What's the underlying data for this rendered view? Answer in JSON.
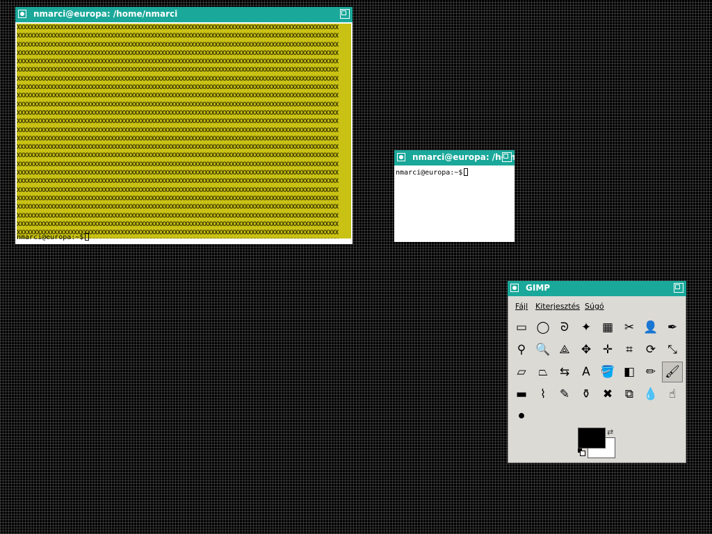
{
  "terminal_main": {
    "title": "nmarci@europa: /home/nmarci",
    "prompt": "nmarci@europa:~$",
    "pattern_text": "XXXXXXXXXXXXXXXXXXXXXXXXXXXXXXXXXXXXXXXXXXXXXXXXXXXXXXXXXXXXXXXXXXXXXXXXXXXXXXXXXXXXXXXXXXXXXXXX",
    "background_color": "#c9c214"
  },
  "terminal_small": {
    "title": "nmarci@europa: /hom",
    "prompt": "nmarci@europa:~$"
  },
  "gimp": {
    "title": "GIMP",
    "menu": {
      "file": "Fájl",
      "extensions": "Kiterjesztés",
      "help": "Súgó"
    },
    "tools": [
      {
        "name": "rect-select-icon",
        "glyph": "▭"
      },
      {
        "name": "ellipse-select-icon",
        "glyph": "◯"
      },
      {
        "name": "lasso-icon",
        "glyph": "ᘐ"
      },
      {
        "name": "magic-wand-icon",
        "glyph": "✦"
      },
      {
        "name": "select-by-color-icon",
        "glyph": "▦"
      },
      {
        "name": "scissors-icon",
        "glyph": "✂"
      },
      {
        "name": "foreground-select-icon",
        "glyph": "👤"
      },
      {
        "name": "paths-icon",
        "glyph": "✒"
      },
      {
        "name": "color-picker-icon",
        "glyph": "⚲"
      },
      {
        "name": "zoom-icon",
        "glyph": "🔍"
      },
      {
        "name": "measure-icon",
        "glyph": "⟁"
      },
      {
        "name": "move-icon",
        "glyph": "✥"
      },
      {
        "name": "align-icon",
        "glyph": "✛"
      },
      {
        "name": "crop-icon",
        "glyph": "⌗"
      },
      {
        "name": "rotate-icon",
        "glyph": "⟳"
      },
      {
        "name": "scale-icon",
        "glyph": "⤡"
      },
      {
        "name": "shear-icon",
        "glyph": "▱"
      },
      {
        "name": "perspective-icon",
        "glyph": "⏢"
      },
      {
        "name": "flip-icon",
        "glyph": "⇆"
      },
      {
        "name": "text-icon",
        "glyph": "A"
      },
      {
        "name": "bucket-fill-icon",
        "glyph": "🪣"
      },
      {
        "name": "gradient-icon",
        "glyph": "◧"
      },
      {
        "name": "pencil-icon",
        "glyph": "✏"
      },
      {
        "name": "paintbrush-icon",
        "glyph": "🖌"
      },
      {
        "name": "eraser-icon",
        "glyph": "▬"
      },
      {
        "name": "airbrush-icon",
        "glyph": "⌇"
      },
      {
        "name": "ink-icon",
        "glyph": "✎"
      },
      {
        "name": "clone-icon",
        "glyph": "⚱"
      },
      {
        "name": "healing-icon",
        "glyph": "✖"
      },
      {
        "name": "perspective-clone-icon",
        "glyph": "⧉"
      },
      {
        "name": "blur-icon",
        "glyph": "💧"
      },
      {
        "name": "smudge-icon",
        "glyph": "☝"
      },
      {
        "name": "dodge-burn-icon",
        "glyph": "⚫"
      }
    ],
    "active_tool_index": 23,
    "foreground_color": "#000000",
    "background_color": "#ffffff"
  }
}
